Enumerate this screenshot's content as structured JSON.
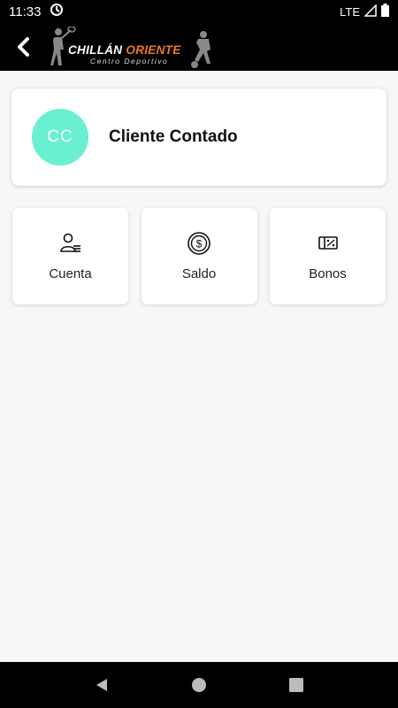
{
  "status_bar": {
    "time": "11:33",
    "network": "LTE"
  },
  "app_bar": {
    "logo": {
      "brand_part1": "CHILLÁN ",
      "brand_part2": "ORIENTE",
      "tagline": "Centro Deportivo"
    }
  },
  "profile": {
    "initials": "CC",
    "name": "Cliente Contado",
    "avatar_color": "#68f0d0"
  },
  "menu": [
    {
      "label": "Cuenta",
      "icon": "user-list-icon"
    },
    {
      "label": "Saldo",
      "icon": "coin-icon"
    },
    {
      "label": "Bonos",
      "icon": "voucher-percent-icon"
    }
  ],
  "colors": {
    "accent": "#f07a1a",
    "background": "#f7f7f7",
    "bar": "#000000"
  }
}
